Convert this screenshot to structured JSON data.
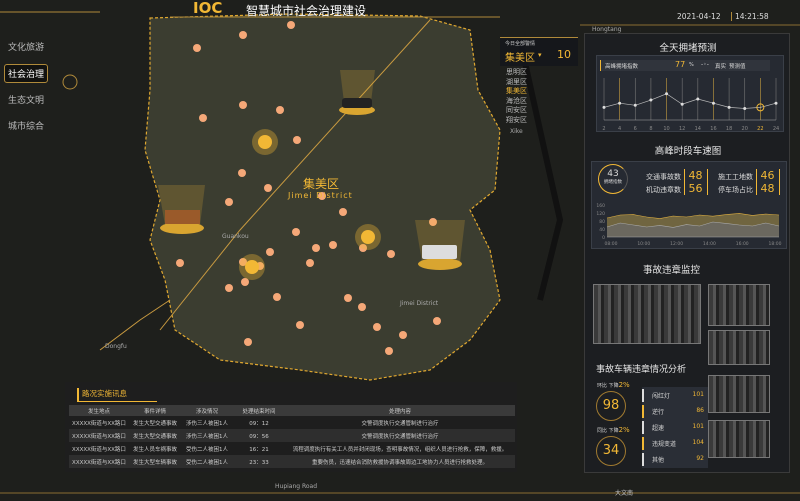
{
  "header": {
    "logo": "IOC",
    "title": "智慧城市社会治理建设",
    "date": "2021-04-12",
    "time": "14:21:58"
  },
  "nav": {
    "items": [
      {
        "label": "文化旅游"
      },
      {
        "label": "社会治理",
        "active": true
      },
      {
        "label": "生态文明"
      },
      {
        "label": "城市综合"
      }
    ]
  },
  "district": {
    "caption": "今日全部警情",
    "selected": "集美区",
    "count": "10",
    "options": [
      "思明区",
      "湖里区",
      "集美区",
      "海沧区",
      "同安区",
      "翔安区"
    ]
  },
  "map": {
    "district_cn": "集美区",
    "district_en": "Jimei District",
    "labels": [
      "Hongtang",
      "Xike",
      "Guankou",
      "Dongfu",
      "Jimei District",
      "大文南",
      "Hupiang Road"
    ]
  },
  "congestion": {
    "title": "全天拥堵预测",
    "peak_label": "高峰拥堵指数",
    "peak_value": "77",
    "unit": "%",
    "legend_real": "真实",
    "legend_pred": "预测值",
    "chart_data": {
      "type": "line",
      "x": [
        2,
        4,
        6,
        8,
        10,
        12,
        14,
        16,
        18,
        20,
        22,
        24
      ],
      "xunit": "h",
      "values": [
        52,
        56,
        54,
        59,
        65,
        55,
        60,
        56,
        52,
        51,
        52,
        56
      ],
      "highlight_x": 22
    }
  },
  "speed": {
    "title": "高峰时段车速图",
    "index_value": "43",
    "index_label": "拥堵指数",
    "stats": [
      {
        "label": "交通事故数",
        "value": "48"
      },
      {
        "label": "施工工地数",
        "value": "46"
      },
      {
        "label": "机动违章数",
        "value": "56"
      },
      {
        "label": "停车场占比",
        "value": "48"
      }
    ],
    "chart_data": {
      "type": "area",
      "x": [
        "08:00",
        "10:00",
        "12:00",
        "14:00",
        "16:00",
        "18:00"
      ],
      "yticks": [
        0,
        40,
        80,
        120,
        160
      ],
      "ylim": [
        0,
        160
      ],
      "series": [
        {
          "values": [
            95,
            110,
            112,
            100,
            92,
            105,
            100,
            110,
            104,
            112,
            118,
            108,
            115,
            110
          ]
        },
        {
          "values": [
            50,
            70,
            60,
            50,
            58,
            48,
            62,
            55,
            75,
            68,
            60,
            55,
            70,
            55
          ]
        }
      ]
    }
  },
  "monitor": {
    "title": "事故违章监控"
  },
  "violations": {
    "title": "事故车辆违章情况分析",
    "mom": {
      "label": "环比 下降",
      "pct": "2%",
      "value": "98"
    },
    "yoy": {
      "label": "同比 下降",
      "pct": "2%",
      "value": "34"
    },
    "items": [
      {
        "label": "闯红灯",
        "value": "101"
      },
      {
        "label": "逆行",
        "value": "86"
      },
      {
        "label": "超速",
        "value": "101"
      },
      {
        "label": "违规变道",
        "value": "104"
      },
      {
        "label": "其他",
        "value": "92"
      }
    ]
  },
  "incidents": {
    "title": "路况实施讯息",
    "headers": [
      "发生地点",
      "事件详情",
      "涉及情况",
      "处理结束时间",
      "处理内容"
    ],
    "rows": [
      [
        "XXXXX街道与XX路口",
        "发生大型交通事故",
        "涉伤三人被困1人",
        "09：12",
        "交警调度执行交通管制进行治疗"
      ],
      [
        "XXXXX街道与XX路口",
        "发生大型交通事故",
        "涉伤三人被困1人",
        "09：56",
        "交警调度执行交通管制进行治疗"
      ],
      [
        "XXXXX街道与XX路口",
        "发生人员车祸事故",
        "受伤二人被困1人",
        "16：21",
        "流程调度执行有关工人员并封闭现场，查明事故情况，组织人员进行抢救，保障，救援。"
      ],
      [
        "XXXXX街道与XX路口",
        "发生大型车辆事故",
        "受伤二人被困1人",
        "23：33",
        "重要伤员，迅速结合消防救援协调事故周边工地协力人员进行抢救处理。"
      ]
    ]
  }
}
